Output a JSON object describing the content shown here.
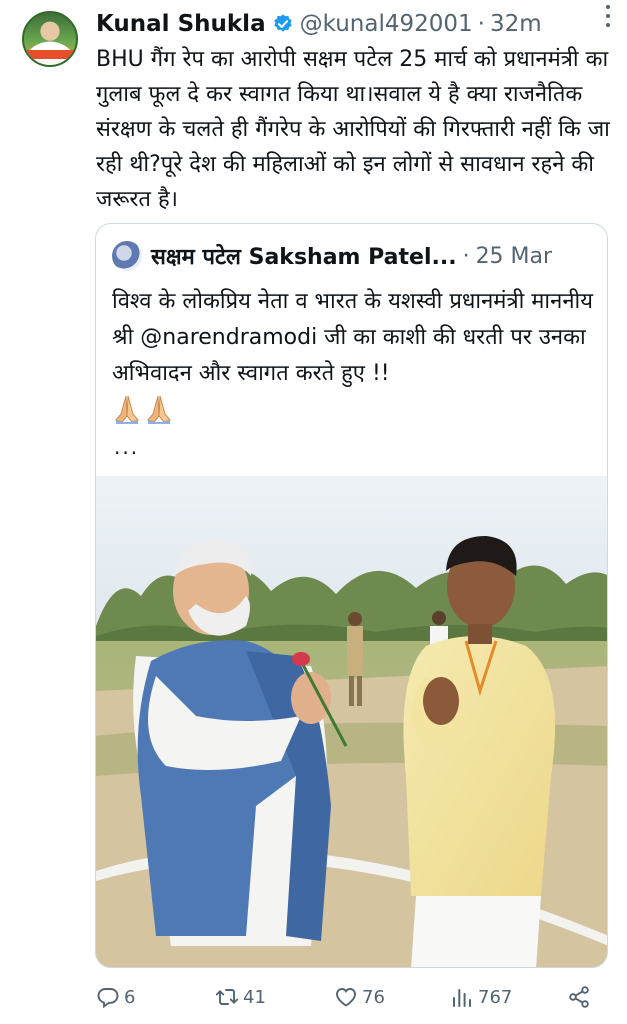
{
  "author": {
    "display_name": "Kunal Shukla",
    "handle": "@kunal492001",
    "separator": "·",
    "time": "32m",
    "verified_color": "#1d9bf0"
  },
  "tweet": {
    "text": "BHU गैंग रेप का आरोपी सक्षम पटेल 25 मार्च को प्रधानमंत्री का गुलाब फूल दे कर स्वागत किया था।सवाल ये है क्या राजनैतिक संरक्षण के चलते ही गैंगरेप के आरोपियों की गिरफ्तारी नहीं कि जा रही थी?पूरे देश की महिलाओं को इन लोगों से सावधान रहने की जरूरत है।"
  },
  "quoted_tweet": {
    "display_name": "सक्षम पटेल Saksham Patel...",
    "separator": "·",
    "date": "25 Mar",
    "text": "विश्व के लोकप्रिय नेता व भारत के यशस्वी प्रधानमंत्री माननीय श्री @narendramodi जी का काशी की धरती पर उनका अभिवादन और स्वागत करते हुए !!",
    "emoji": "🙏🏻🙏🏻",
    "truncation": "...",
    "mention_color": "#0f1419"
  },
  "actions": {
    "replies": "6",
    "retweets": "41",
    "likes": "76",
    "views": "767"
  },
  "icons": {
    "verified": "verified-badge-icon",
    "more": "more-vertical-icon",
    "reply": "reply-icon",
    "retweet": "retweet-icon",
    "like": "heart-icon",
    "views": "views-bar-chart-icon",
    "share": "share-icon"
  },
  "colors": {
    "text_primary": "#0f1419",
    "text_secondary": "#536471",
    "border": "#cfd9de",
    "accent": "#1d9bf0"
  }
}
